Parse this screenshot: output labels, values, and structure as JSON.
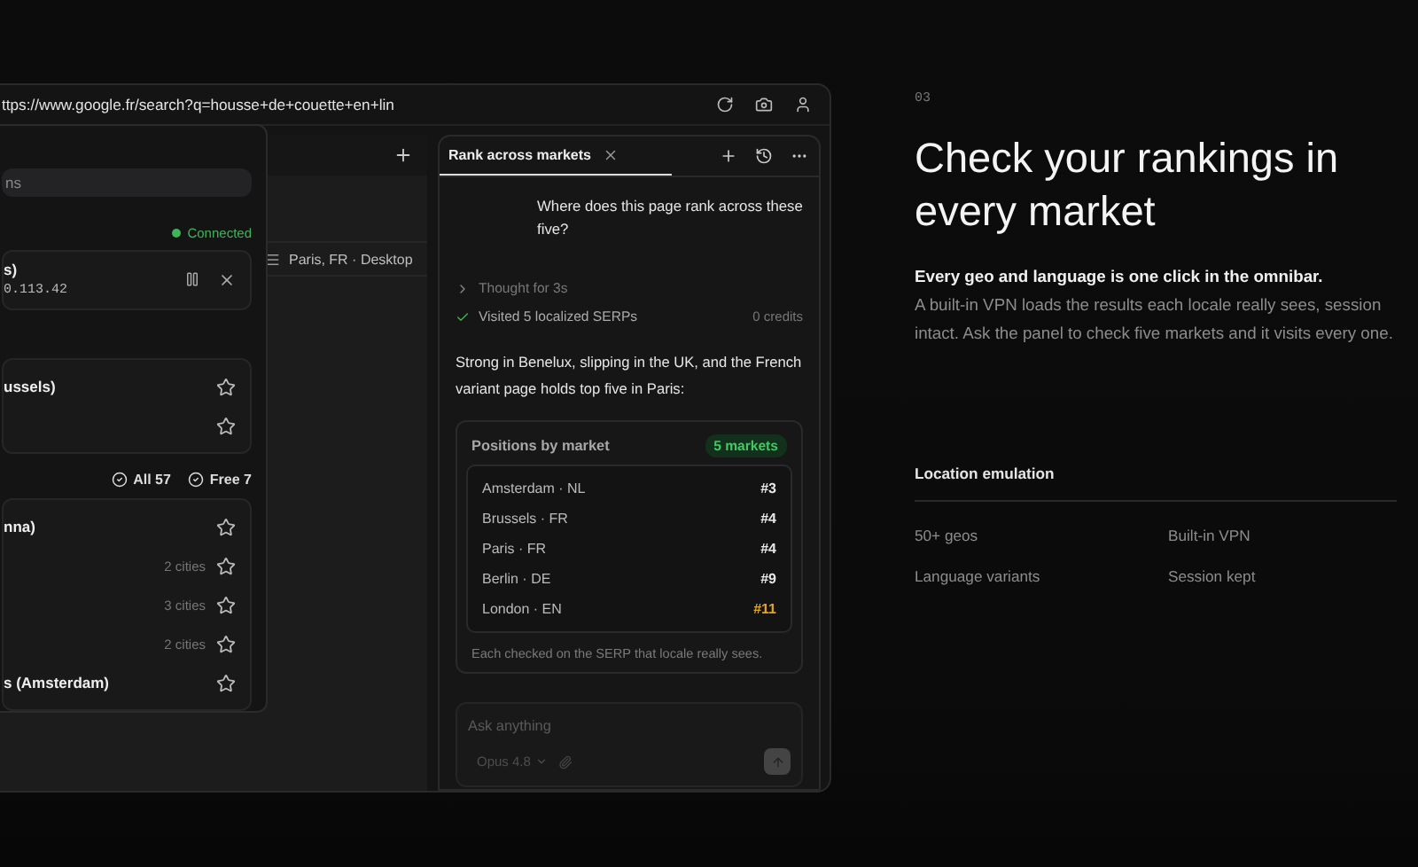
{
  "browser": {
    "url": "ttps://www.google.fr/search?q=housse+de+couette+en+lin",
    "location": "Paris, FR · Desktop",
    "location_panel": {
      "search": {
        "placeholder": "ns"
      },
      "status": "Connected",
      "current": {
        "name": "s)",
        "ip": "0.113.42"
      },
      "favorites": [
        {
          "name": "ussels)",
          "starred": false
        },
        {
          "starred": false
        }
      ],
      "filters": [
        "All 57",
        "Free 7"
      ],
      "countries": [
        {
          "name": "nna)",
          "starred": false
        },
        {
          "count": "2 cities",
          "starred": false
        },
        {
          "count": "3 cities",
          "starred": false
        },
        {
          "count": "2 cities",
          "starred": false
        },
        {
          "name": "s (Amsterdam)",
          "starred": false
        }
      ]
    }
  },
  "assistant": {
    "tabs": [
      {
        "label": "Rank across markets",
        "selected": true
      }
    ],
    "question": "Where does this page rank across these five?",
    "steps": [
      {
        "kind": "thought",
        "label": "Thought for 3s"
      },
      {
        "kind": "done",
        "label": "Visited 5 localized SERPs",
        "meta": "0 credits"
      }
    ],
    "answer": "Strong in Benelux, slipping in the UK, and the French variant page holds top five in Paris:",
    "card": {
      "title": "Positions by market",
      "badge": "5 markets",
      "rows": [
        {
          "market": "Amsterdam · NL",
          "rank": "#3",
          "color": "#e8e8e8"
        },
        {
          "market": "Brussels · FR",
          "rank": "#4",
          "color": "#e8e8e8"
        },
        {
          "market": "Paris · FR",
          "rank": "#4",
          "color": "#e8e8e8"
        },
        {
          "market": "Berlin · DE",
          "rank": "#9",
          "color": "#e8e8e8"
        },
        {
          "market": "London · EN",
          "rank": "#11",
          "color": "#e0a526"
        }
      ],
      "note": "Each checked on the SERP that locale really sees."
    },
    "composer": {
      "placeholder": "Ask anything",
      "model": "Opus 4.8"
    }
  },
  "feature": {
    "number": "03",
    "title": "Check your rankings in every market",
    "lead": "Every geo and language is one click in the omnibar.",
    "body": "A built-in VPN loads the results each locale really sees, session intact. Ask the panel to check five markets and it visits every one.",
    "section": "Location emulation",
    "items": [
      "50+ geos",
      "Built-in VPN",
      "Language variants",
      "Session kept"
    ]
  }
}
